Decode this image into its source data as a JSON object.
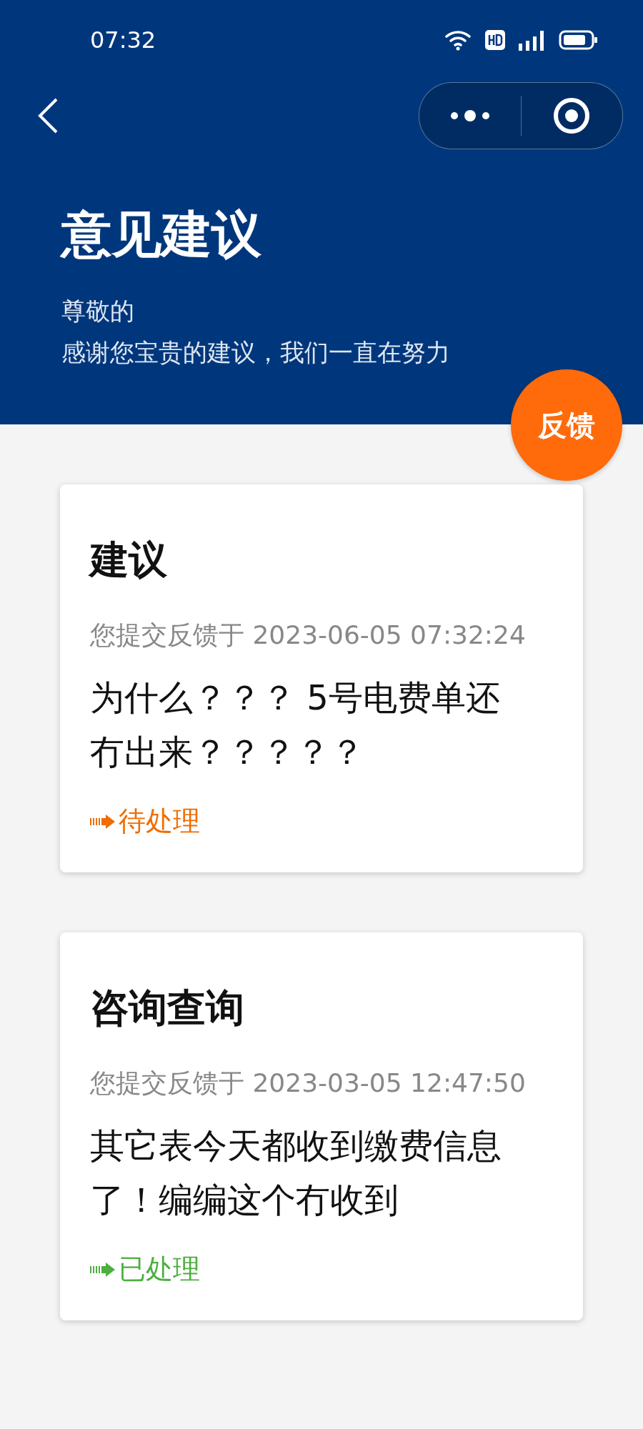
{
  "status_bar": {
    "time": "07:32"
  },
  "header": {
    "title": "意见建议",
    "greeting": "尊敬的",
    "subtitle": "感谢您宝贵的建议，我们一直在努力"
  },
  "feedback_button": {
    "label": "反馈"
  },
  "feedback_items": [
    {
      "category": "建议",
      "submitted": "您提交反馈于 2023-06-05 07:32:24",
      "content": "为什么？？？ 5号电费单还冇出来？？？？？",
      "status": "待处理",
      "color": "#ef6c00"
    },
    {
      "category": "咨询查询",
      "submitted": "您提交反馈于 2023-03-05 12:47:50",
      "content": "其它表今天都收到缴费信息了！编编这个冇收到",
      "status": "已处理",
      "color": "#4caf3f"
    }
  ]
}
